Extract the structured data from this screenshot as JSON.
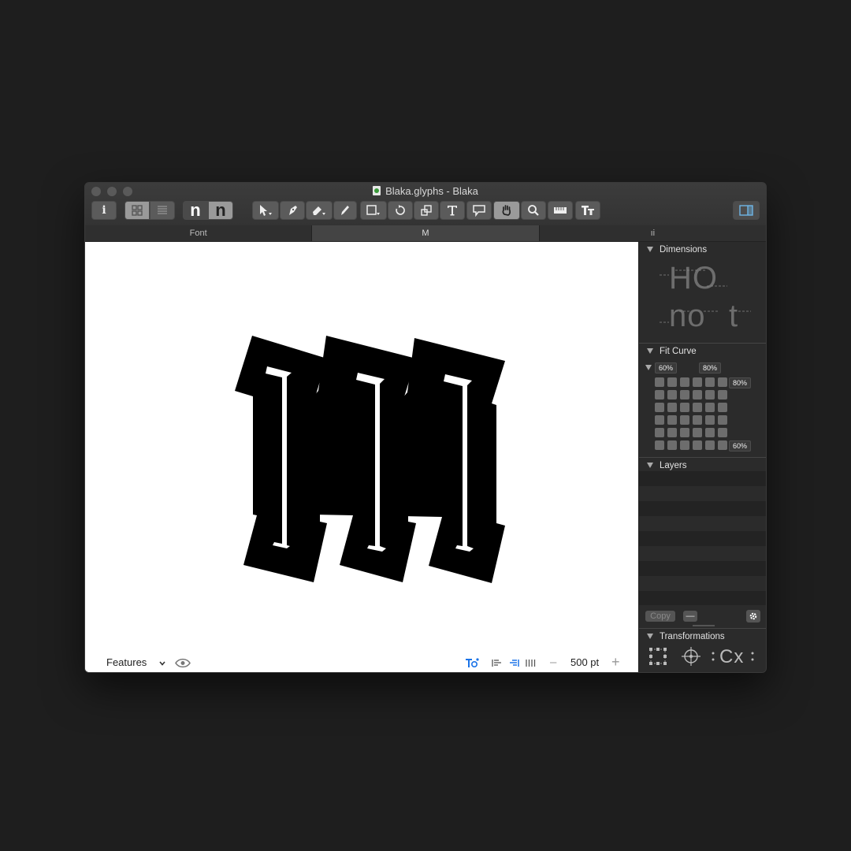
{
  "window": {
    "title": "Blaka.glyphs - Blaka"
  },
  "toolbar": {
    "info_label": "i",
    "preview_n_1": "n",
    "preview_n_2": "n"
  },
  "tabs": [
    {
      "label": "Font",
      "active": false
    },
    {
      "label": "M",
      "active": true
    },
    {
      "label": "ıi",
      "active": false
    }
  ],
  "bottom_bar": {
    "features_label": "Features",
    "size_label": "500 pt",
    "minus_label": "–",
    "plus_label": "+"
  },
  "panel": {
    "dimensions": {
      "title": "Dimensions",
      "preview_top": "HO",
      "preview_bottom_left": "no",
      "preview_bottom_right": "t"
    },
    "fit_curve": {
      "title": "Fit Curve",
      "top_left": "60%",
      "top_right": "80%",
      "right_top": "80%",
      "right_bottom": "60%"
    },
    "layers": {
      "title": "Layers",
      "copy_label": "Copy",
      "remove_label": "—"
    },
    "transformations": {
      "title": "Transformations",
      "cx_label": "Cx"
    }
  },
  "colors": {
    "accent_blue": "#1a73e8",
    "panel_bg": "#2b2b2b",
    "canvas_bg": "#ffffff"
  }
}
